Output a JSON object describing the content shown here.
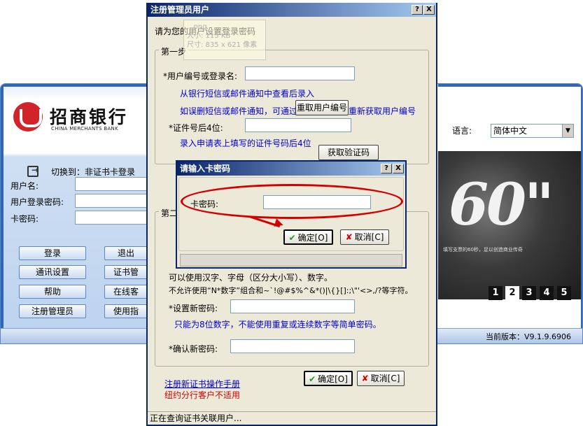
{
  "bank": {
    "logo_cn": "招商银行",
    "logo_en": "CHINA MERCHANTS BANK",
    "switch_text": "切换到：非证书卡登录",
    "labels": {
      "user": "用户名:",
      "login_pwd": "用户登录密码:",
      "card_pwd": "卡密码:"
    },
    "buttons": {
      "login": "登录",
      "logout": "退出",
      "comm": "通讯设置",
      "cert": "证书管",
      "help": "帮助",
      "online": "在线客",
      "register": "注册管理员",
      "guide": "使用指"
    },
    "language_label": "语言:",
    "language_value": "简体中文",
    "banner_number": "60\"",
    "banner_sub": "填写支票的60秒，足以创造商业传奇",
    "pages": [
      "1",
      "2",
      "3",
      "4",
      "5"
    ],
    "active_page": 2,
    "version": "当前版本：V9.1.9.6906"
  },
  "ghost": {
    "line1": "...png",
    "line2": "大小: 115 KB",
    "line3": "尺寸: 835 x 621 像素"
  },
  "register": {
    "title": "注册管理员用户",
    "help_btn": "?",
    "close_btn": "X",
    "intro": "请为您的用户设置登录密码",
    "step1_title": "第一步",
    "step2_title": "第二",
    "user_no_label": "*用户编号或登录名:",
    "hint1": "从银行短信或邮件通知中查看后录入",
    "hint2_pre": "如误删短信或邮件通知，可通过",
    "retrieve_btn": "重取用户编号",
    "hint2_post": "重新获取用户编号",
    "cert_label": "*证件号后4位:",
    "cert_hint": "录入申请表上填写的证件号码后4位",
    "get_code_btn": "获取验证码",
    "rule1": "可以使用汉字、字母（区分大小写）、数字。",
    "rule2": "不允许使用“N*数字”组合和~`!@#$%^&*()|\\{}[]:;\\\"'<>,/?等字符。",
    "new_pwd_label": "*设置新密码:",
    "new_pwd_hint": "只能为8位数字，不能使用重复或连续数字等简单密码。",
    "confirm_pwd_label": "*确认新密码:",
    "manual_link": "注册新证书操作手册",
    "ny_note": "纽约分行客户不适用",
    "ok_btn": "确定[O]",
    "cancel_btn": "取消[C]",
    "status": "正在查询证书关联用户..."
  },
  "card_dialog": {
    "title": "请输入卡密码",
    "help_btn": "?",
    "close_btn": "X",
    "pwd_label": "卡密码:",
    "ok_btn": "确定[O]",
    "cancel_btn": "取消[C]"
  },
  "colors": {
    "title_bar": "#0a246a",
    "bank_blue": "#2f66b9",
    "annotation_red": "#d40000",
    "dialog_face": "#ece9d8"
  }
}
